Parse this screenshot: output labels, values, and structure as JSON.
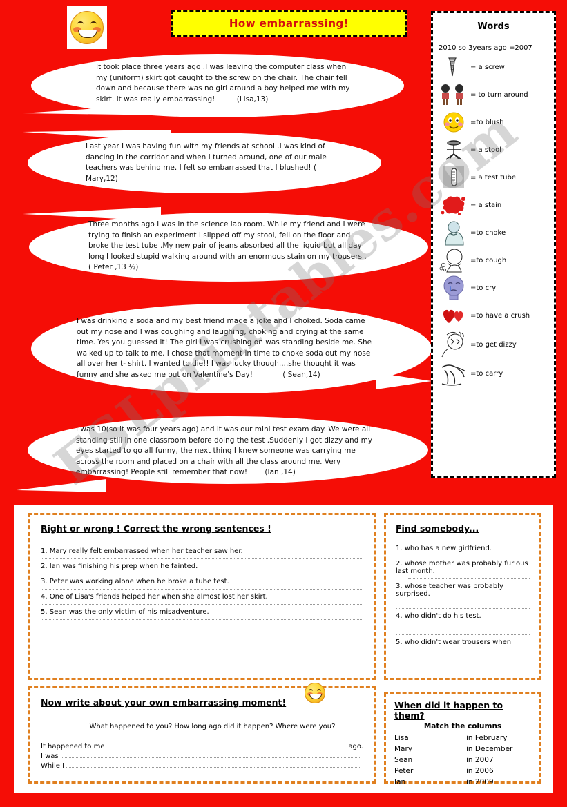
{
  "page": {
    "background_color": "#f50d06",
    "title": "How embarrassing!",
    "watermark": "ESLprintables.com"
  },
  "icons": {
    "top_smiley": "embarrassed-blushing-smiley",
    "bottom_smiley": "embarrassed-blushing-smiley"
  },
  "stories": [
    {
      "id": "lisa",
      "text": "It took place three years ago .I was leaving the computer class when my (uniform) skirt got caught to the screw on the chair. The chair fell down and because there was no girl around a boy helped me with my skirt. It was really embarrassing!",
      "signature": "(Lisa,13)"
    },
    {
      "id": "mary",
      "text": "Last year I was having fun with my friends at school .I was kind of dancing in the corridor and when I turned around, one of our male teachers was behind me. I felt so embarrassed that I blushed!",
      "signature": "( Mary,12)"
    },
    {
      "id": "peter",
      "text": "Three months ago I was in the science lab room. While  my friend and I were trying to finish an experiment  I slipped off my stool, fell on the floor and broke the test  tube .My new pair of jeans absorbed all the liquid but all day long I looked stupid walking around with an enormous  stain on my trousers .",
      "signature": "( Peter ,13 ½)"
    },
    {
      "id": "sean",
      "text": "I was drinking a soda and my best friend made a joke and I choked. Soda came out my nose and I was coughing and laughing, choking and crying at the same time. Yes you guessed it! The girl I was crushing on was standing beside me.  She walked up to talk to me. I chose that moment in time to choke soda out my nose all over her t- shirt. I wanted to die!! I was lucky though....she thought it was funny and she asked me out on Valentine's Day!",
      "signature": "( Sean,14)"
    },
    {
      "id": "ian",
      "text": "I was 10(so it was four years ago) and it was our mini test exam day. We were all standing still in one classroom before doing the test .Suddenly I got dizzy and my eyes started to go all funny, the next thing I knew someone was carrying me across the room and placed on a chair with all the class around me. Very embarrassing! People still remember that now!",
      "signature": "(Ian ,14)"
    }
  ],
  "words_panel": {
    "title": "Words",
    "note": "2010 so 3years ago =2007",
    "entries": [
      {
        "icon": "screw-icon",
        "label": "= a screw"
      },
      {
        "icon": "two-people-icon",
        "label": "= to turn around"
      },
      {
        "icon": "blushing-face-icon",
        "label": "=to blush"
      },
      {
        "icon": "stool-icon",
        "label": "= a stool"
      },
      {
        "icon": "test-tube-icon",
        "label": "= a test tube"
      },
      {
        "icon": "red-stain-icon",
        "label": "= a stain"
      },
      {
        "icon": "choking-person-icon",
        "label": "=to choke"
      },
      {
        "icon": "coughing-person-icon",
        "label": "=to cough"
      },
      {
        "icon": "crying-face-icon",
        "label": "=to cry"
      },
      {
        "icon": "red-hearts-icon",
        "label": "=to have a crush"
      },
      {
        "icon": "dizzy-person-icon",
        "label": "=to get dizzy"
      },
      {
        "icon": "carrying-person-icon",
        "label": "=to carry"
      }
    ]
  },
  "exercise_right_wrong": {
    "title": "Right or wrong ! Correct the wrong sentences !",
    "items": [
      "1. Mary really felt embarrassed when her teacher saw her.",
      "2. Ian was finishing his prep when he fainted.",
      "3. Peter was working alone when he broke a tube test.",
      "4. One of Lisa's friends helped her when she almost lost her skirt.",
      "5. Sean was the only victim of his misadventure."
    ]
  },
  "exercise_find_somebody": {
    "title": "Find somebody...",
    "items": [
      "1. who has a new girlfriend.",
      "2. whose mother was probably furious last month.",
      "3. whose teacher was probably surprised.",
      "4. who didn't do his test.",
      "5. who didn't wear trousers when"
    ]
  },
  "exercise_write": {
    "title": "Now write about your own embarrassing moment!",
    "prompt": "What happened to you? How long ago did it happen? Where were you?",
    "lines": [
      {
        "lead": "It happened to me",
        "tail": "ago."
      },
      {
        "lead": "I was",
        "tail": ""
      },
      {
        "lead": "While I",
        "tail": ""
      }
    ]
  },
  "exercise_match": {
    "title": "When did it happen to them?",
    "subtitle": "Match the columns",
    "rows": [
      {
        "name": "Lisa",
        "date": "in February"
      },
      {
        "name": "Mary",
        "date": "in December"
      },
      {
        "name": "Sean",
        "date": "in 2007"
      },
      {
        "name": "Peter",
        "date": "in 2006"
      },
      {
        "name": "Ian",
        "date": "in 2009"
      }
    ]
  }
}
